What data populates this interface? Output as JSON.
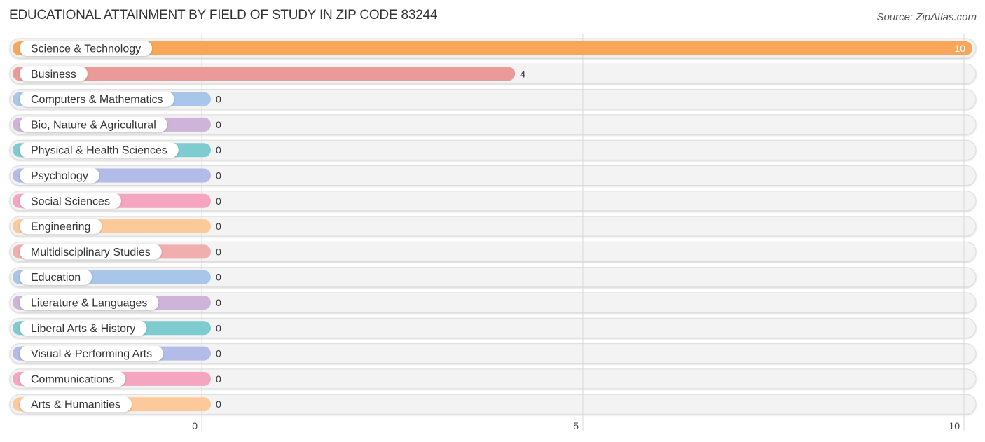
{
  "chart_data": {
    "type": "bar",
    "orientation": "horizontal",
    "title": "EDUCATIONAL ATTAINMENT BY FIELD OF STUDY IN ZIP CODE 83244",
    "source": "Source: ZipAtlas.com",
    "xlabel": "",
    "ylabel": "",
    "xlim": [
      0,
      10
    ],
    "xticks": [
      0,
      5,
      10
    ],
    "grid": true,
    "categories": [
      "Science & Technology",
      "Business",
      "Computers & Mathematics",
      "Bio, Nature & Agricultural",
      "Physical & Health Sciences",
      "Psychology",
      "Social Sciences",
      "Engineering",
      "Multidisciplinary Studies",
      "Education",
      "Literature & Languages",
      "Liberal Arts & History",
      "Visual & Performing Arts",
      "Communications",
      "Arts & Humanities"
    ],
    "values": [
      10,
      4,
      0,
      0,
      0,
      0,
      0,
      0,
      0,
      0,
      0,
      0,
      0,
      0,
      0
    ],
    "colors": [
      "#f7a65a",
      "#ec9a98",
      "#a8c5ea",
      "#cdb4d8",
      "#7ecbd0",
      "#b3bbe8",
      "#f5a5c0",
      "#fbc99a",
      "#f0aeae",
      "#a8c5ea",
      "#cdb4d8",
      "#7ecbd0",
      "#b3bbe8",
      "#f5a5c0",
      "#fbc99a"
    ]
  }
}
